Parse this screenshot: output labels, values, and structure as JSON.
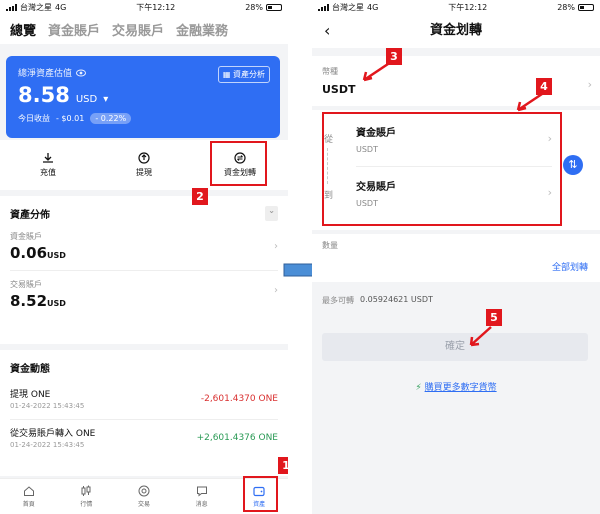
{
  "status": {
    "carrier": "台灣之星",
    "network": "4G",
    "time": "下午12:12",
    "battery": "28%"
  },
  "left": {
    "tabs": [
      "總覽",
      "資金賬戶",
      "交易賬戶",
      "金融業務"
    ],
    "card": {
      "label": "總淨資產估值",
      "value": "8.58",
      "currency": "USD",
      "today_label": "今日收益",
      "today_value": "- $0.01",
      "today_pct": "- 0.22%",
      "analysis": "資產分析"
    },
    "actions": [
      "充值",
      "提現",
      "資金划轉"
    ],
    "distribution_title": "資產分佈",
    "accounts": [
      {
        "name": "資金賬戶",
        "value": "0.06",
        "unit": "USD"
      },
      {
        "name": "交易賬戶",
        "value": "8.52",
        "unit": "USD"
      }
    ],
    "activity_title": "資金動態",
    "transactions": [
      {
        "title": "提現 ONE",
        "date": "01-24-2022 15:43:45",
        "amount": "-2,601.4370 ONE"
      },
      {
        "title": "從交易賬戶轉入 ONE",
        "date": "01-24-2022 15:43:45",
        "amount": "+2,601.4376 ONE"
      }
    ],
    "tabbar": [
      "首頁",
      "行情",
      "交易",
      "消息",
      "資產"
    ]
  },
  "right": {
    "title": "資金划轉",
    "currency_label": "幣種",
    "currency_value": "USDT",
    "from_label": "從",
    "from_account": "資金賬戶",
    "from_asset": "USDT",
    "to_label": "到",
    "to_account": "交易賬戶",
    "to_asset": "USDT",
    "amount_label": "數量",
    "transfer_all": "全部划轉",
    "max_label": "最多可轉",
    "max_value": "0.05924621 USDT",
    "confirm": "確定",
    "buy_more": "購買更多數字貨幣"
  },
  "markers": [
    "1",
    "2",
    "3",
    "4",
    "5"
  ],
  "colors": {
    "accent": "#2f6ef3",
    "marker": "#e1171d",
    "negative": "#d93030",
    "positive": "#2a9a55"
  }
}
